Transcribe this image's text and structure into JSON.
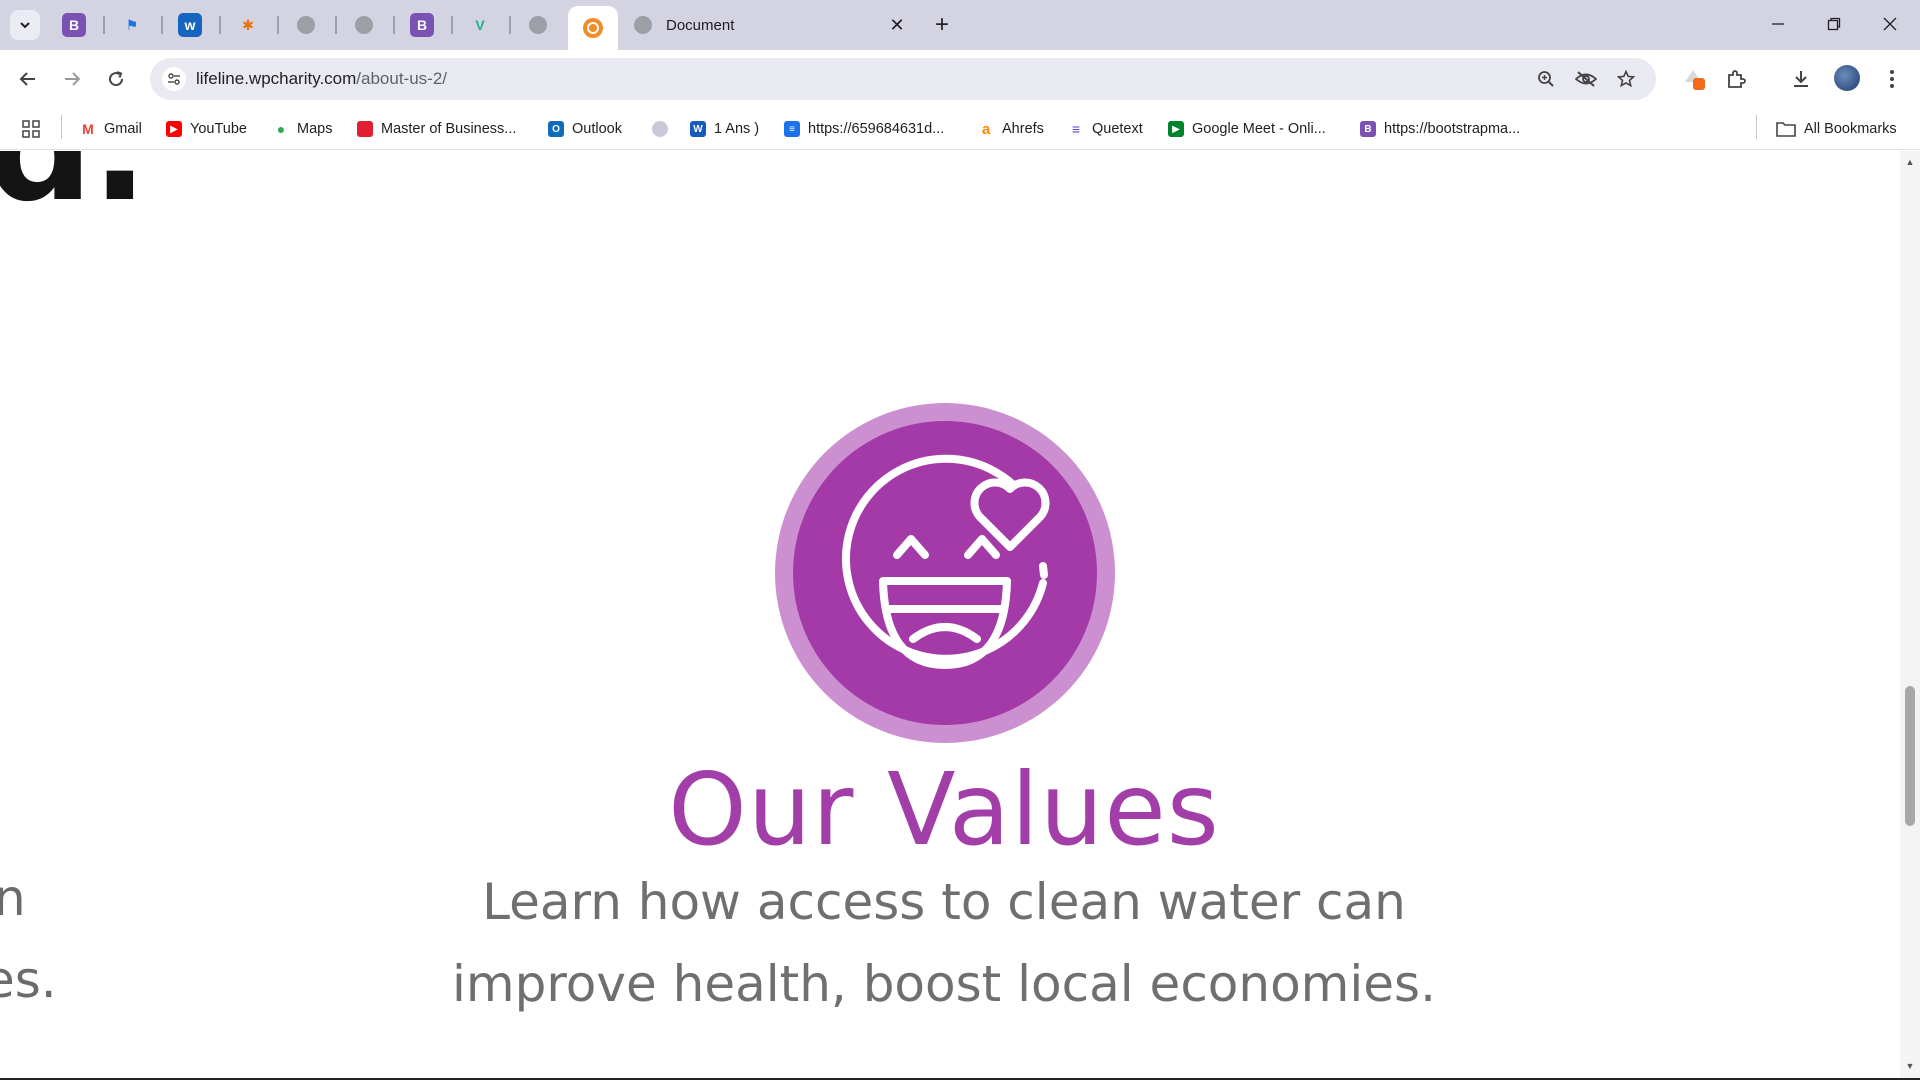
{
  "browser": {
    "active_tab_title": "Document",
    "close_label": "✕",
    "newtab_label": "+",
    "url_host": "lifeline.wpcharity.com",
    "url_path": "/about-us-2/",
    "all_bookmarks_label": "All Bookmarks"
  },
  "pinned_tabs": [
    {
      "name": "bootstrap",
      "glyph": "B",
      "color": "#7952b3"
    },
    {
      "name": "flag",
      "glyph": "⚑",
      "color": "#1a73e8"
    },
    {
      "name": "w-app",
      "glyph": "w",
      "color": "#1565c0"
    },
    {
      "name": "multi",
      "glyph": "✱",
      "color": "#e8710a"
    },
    {
      "name": "globe",
      "glyph": "",
      "color": "#9aa0a6"
    },
    {
      "name": "globe2",
      "glyph": "",
      "color": "#9aa0a6"
    },
    {
      "name": "bootstrap2",
      "glyph": "B",
      "color": "#7952b3"
    },
    {
      "name": "vue",
      "glyph": "V",
      "color": "#1fb584"
    },
    {
      "name": "globe3",
      "glyph": "",
      "color": "#9aa0a6"
    }
  ],
  "bookmarks": [
    {
      "label": "Gmail"
    },
    {
      "label": "YouTube"
    },
    {
      "label": "Maps"
    },
    {
      "label": "Master of Business..."
    },
    {
      "label": "Outlook"
    },
    {
      "label": ""
    },
    {
      "label": "1 Ans )"
    },
    {
      "label": "https://659684631d..."
    },
    {
      "label": "Ahrefs"
    },
    {
      "label": "Quetext"
    },
    {
      "label": "Google Meet - Onli..."
    },
    {
      "label": "https://bootstrapma..."
    }
  ],
  "page": {
    "heading_fragment": "d.",
    "side_fragment_1": "n",
    "side_fragment_2": "es.",
    "values_title": "Our Values",
    "values_line_1": "Learn how access to clean water can",
    "values_line_2": "improve health, boost local economies."
  },
  "colors": {
    "accent_purple": "#a23ea8",
    "icon_ring": "#cc8fd0",
    "icon_fill": "#a33aa8"
  },
  "icons": {
    "values_icon": "smiling-face-with-heart-icon"
  }
}
